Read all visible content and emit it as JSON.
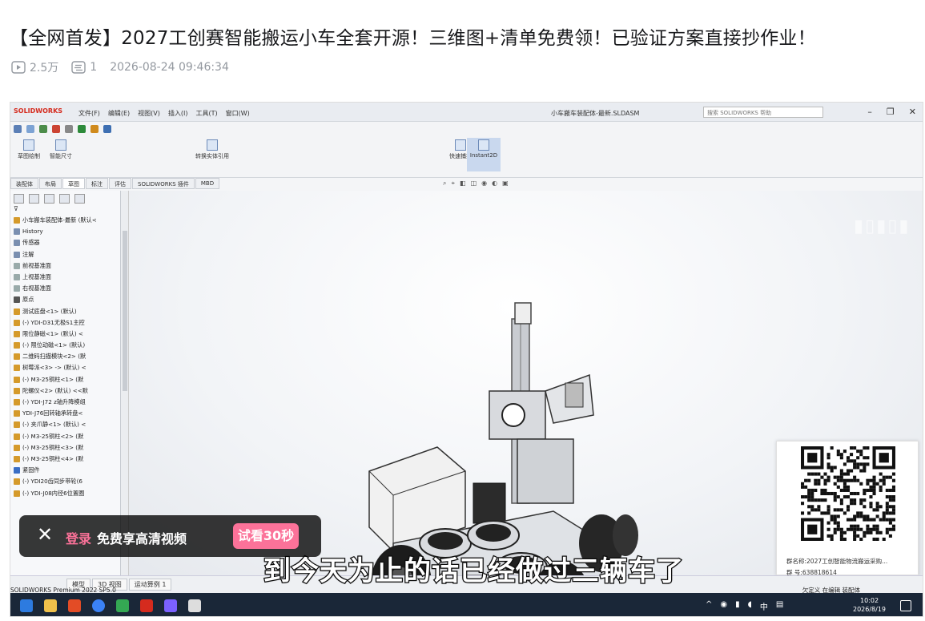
{
  "video": {
    "title": "【全网首发】2027工创赛智能搬运小车全套开源！三维图+清单免费领！已验证方案直接抄作业！",
    "views": "2.5万",
    "danmaku": "1",
    "date": "2026-08-24 09:46:34"
  },
  "solidworks": {
    "logo": "SOLIDWORKS",
    "menus": [
      "文件(F)",
      "编辑(E)",
      "视图(V)",
      "插入(I)",
      "工具(T)",
      "窗口(W)"
    ],
    "doc_title": "小车搬车装配体-最新.SLDASM",
    "search_placeholder": "搜索 SOLIDWORKS 帮助",
    "ribbon_buttons": [
      "草图绘制",
      "智能尺寸",
      "转换实体引用",
      "快速捕捉",
      "Instant2D"
    ],
    "tabs": [
      "装配体",
      "布局",
      "草图",
      "标注",
      "评估",
      "SOLIDWORKS 插件",
      "MBD"
    ],
    "active_tab": "草图",
    "tree_root": "小车搬车装配体-最新 (默认<",
    "tree_items": [
      "History",
      "传感器",
      "注解",
      "前视基准面",
      "上视基准面",
      "右视基准面",
      "原点",
      "测试底盘<1> (默认)",
      "(-) YDI-D31无极S1主控",
      "限位静磁<1> (默认) <",
      "(-) 限位动磁<1> (默认)",
      "二维码扫描模块<2> (默",
      "树莓派<3> -> (默认) <",
      "(-) M3-25铜柱<1> (默",
      "陀螺仪<2> (默认) <<默",
      "(-) YDI-J72 z轴升降模组",
      "YDI-J76回转轴承转盘<",
      "(-) 夹爪静<1> (默认) <",
      "(-) M3-25铜柱<2> (默",
      "(-) M3-25铜柱<3> (默",
      "(-) M3-25铜柱<4> (默",
      "紧固件",
      "(-) YDI20齿同步带轮(6",
      "(-) YDI-J08内径6位置圈"
    ],
    "bottom_tabs": [
      "模型",
      "3D 视图",
      "运动算例 1"
    ],
    "status": "SOLIDWORKS Premium 2022 SP5.0",
    "status_right": "欠定义   在编辑 装配体"
  },
  "qr_card": {
    "line1": "群名称:2027工创智能物流搬运采购...",
    "line2": "群  号:638818614"
  },
  "taskbar": {
    "ime": "中",
    "time": "10:02",
    "date": "2026/8/19"
  },
  "subtitle": "到今天为止的话已经做过三辆车了",
  "login_bar": {
    "login": "登录",
    "promo": "免费享高清视频",
    "trial_button": "试看30秒"
  },
  "colors": {
    "accent_pink": "#fb7299",
    "taskbar_bg": "#1a2738",
    "sw_red": "#d52b1e"
  }
}
